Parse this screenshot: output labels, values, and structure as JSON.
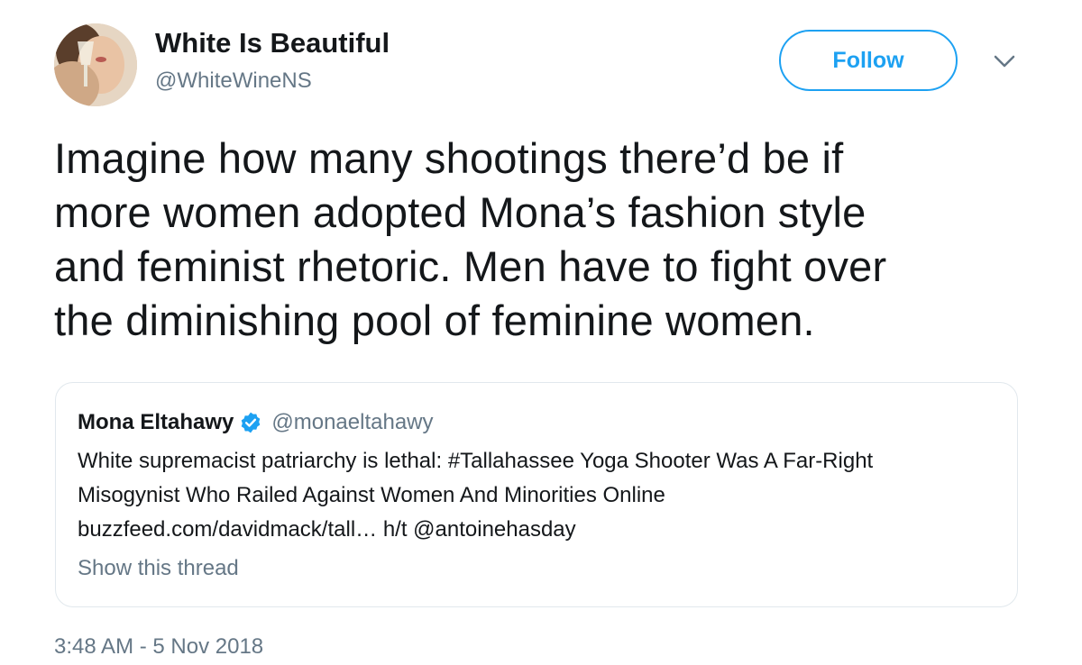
{
  "author": {
    "display_name": "White Is Beautiful",
    "handle": "@WhiteWineNS",
    "avatar_icon": "profile-photo"
  },
  "follow_button": {
    "label": "Follow",
    "color": "#1da1f2"
  },
  "menu": {
    "icon": "chevron-down-icon"
  },
  "tweet": {
    "lines": [
      "Imagine how many shootings there’d be if",
      "more women adopted Mona’s fashion style",
      "and feminist rhetoric. Men have to fight over",
      "the diminishing pool of feminine women."
    ]
  },
  "quoted_tweet": {
    "display_name": "Mona Eltahawy",
    "verified_icon": "verified-badge-icon",
    "verified_color": "#1da1f2",
    "handle": "@monaeltahawy",
    "lines": [
      "White supremacist patriarchy is lethal: #Tallahassee Yoga Shooter Was A Far-Right",
      "Misogynist Who Railed Against Women And Minorities Online",
      "buzzfeed.com/davidmack/tall… h/t @antoinehasday"
    ],
    "show_thread_label": "Show this thread"
  },
  "timestamp": "3:48 AM - 5 Nov 2018",
  "colors": {
    "text_primary": "#14171a",
    "text_secondary": "#657786",
    "border": "#e1e8ed"
  }
}
